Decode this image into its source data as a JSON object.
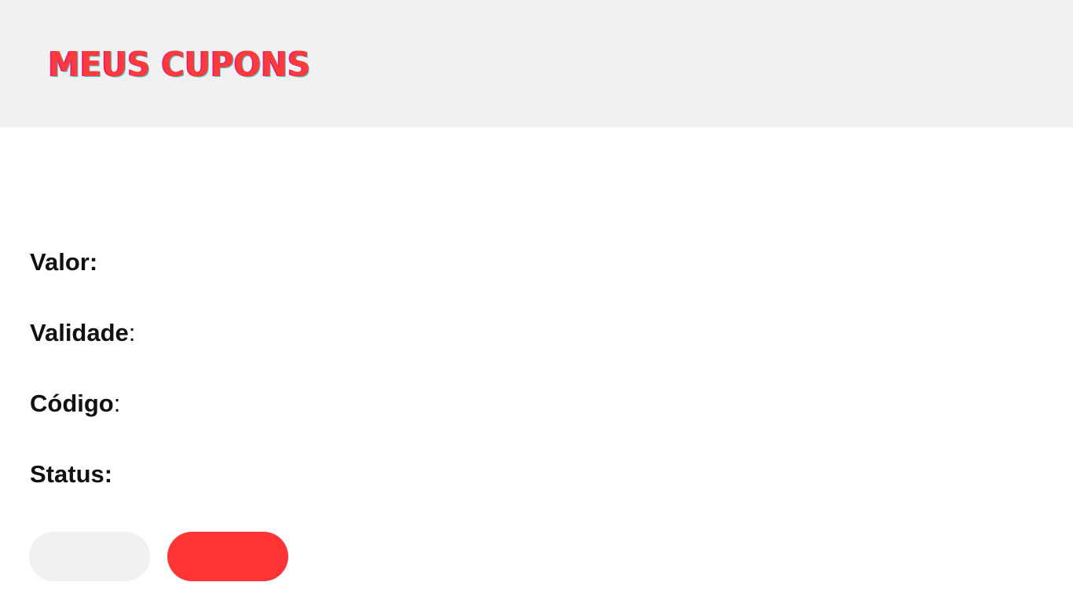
{
  "header": {
    "title": "MEUS CUPONS",
    "background": "#f1f1f1",
    "title_color": "#ff3a3a"
  },
  "coupon": {
    "value_label": "Valor",
    "value_colon": ":",
    "validity_label": "Validade",
    "validity_colon": ":",
    "code_label": "Código",
    "code_colon": ":",
    "status_label": "Status",
    "status_colon": ":"
  },
  "buttons": {
    "secondary_label": "",
    "secondary_color": "#f1f1f1",
    "primary_label": "",
    "primary_color": "#ff3434"
  }
}
